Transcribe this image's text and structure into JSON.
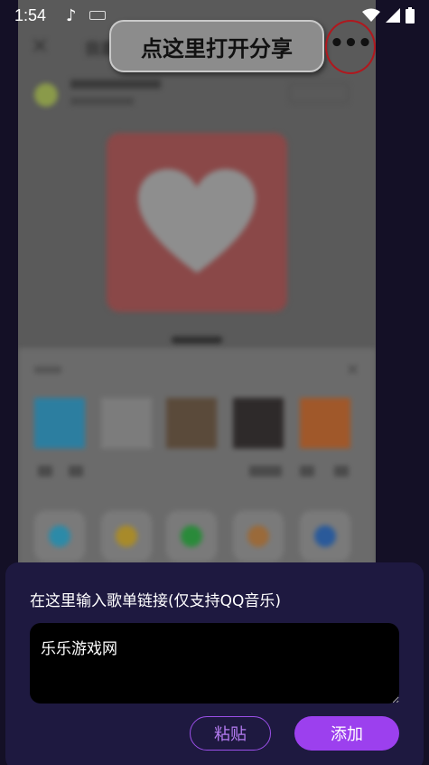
{
  "status_bar": {
    "time": "1:54",
    "icons": [
      "music-note-icon",
      "keyboard-icon",
      "wifi-icon",
      "signal-icon",
      "battery-icon"
    ]
  },
  "tutorial": {
    "header_title_fragment": "我喜",
    "callout_text": "点这里打开分享",
    "more_button_glyph": "•••",
    "share_sheet_close": "✕"
  },
  "dialog": {
    "title": "在这里输入歌单链接(仅支持QQ音乐)",
    "input_value": "乐乐游戏网",
    "paste_label": "粘贴",
    "add_label": "添加"
  },
  "colors": {
    "background": "#141026",
    "dialog_bg": "#1e1940",
    "accent_purple": "#9c40ee",
    "highlight_red": "#b0181e"
  }
}
